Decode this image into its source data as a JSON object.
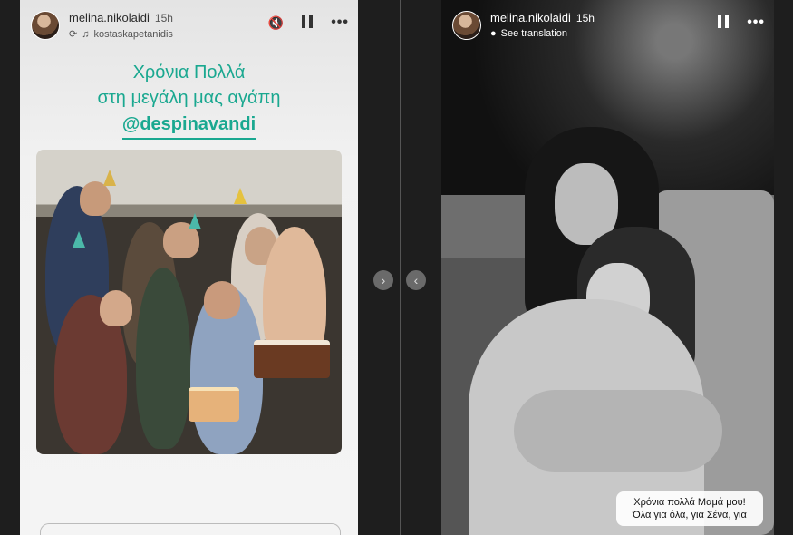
{
  "left_story": {
    "username": "melina.nikolaidi",
    "time": "15h",
    "audio_credit": "kostaskapetanidis",
    "caption_line1": "Χρόνια Πολλά",
    "caption_line2": "στη μεγάλη μας αγάπη",
    "mention": "@despinavandi"
  },
  "right_story": {
    "username": "melina.nikolaidi",
    "time": "15h",
    "translation_label": "See translation",
    "sticker_line1": "Χρόνια πολλά Μαμά μου!",
    "sticker_line2": "Όλα για όλα, για Σένα, για"
  },
  "icons": {
    "mute": "speaker-muted-icon",
    "pause": "pause-icon",
    "more": "more-icon",
    "prev": "chevron-left-icon",
    "next": "chevron-right-icon"
  },
  "colors": {
    "accent_teal": "#1aa890"
  }
}
